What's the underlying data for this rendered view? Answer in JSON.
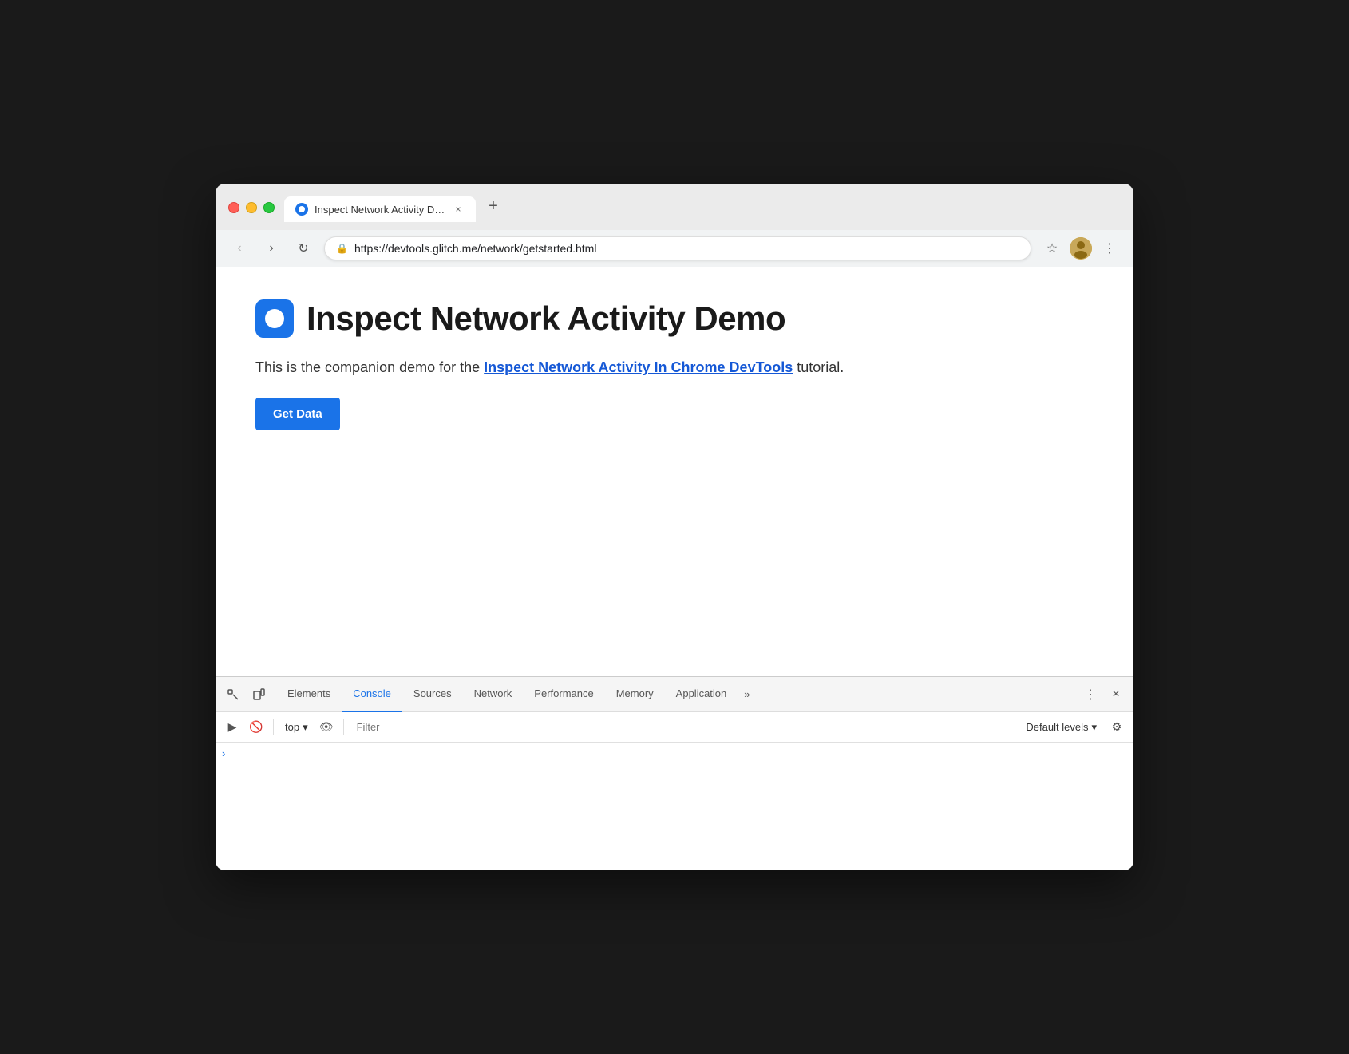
{
  "browser": {
    "traffic_lights": {
      "close_label": "close",
      "minimize_label": "minimize",
      "maximize_label": "maximize"
    },
    "tab": {
      "title": "Inspect Network Activity Demo",
      "close_label": "×"
    },
    "new_tab_label": "+",
    "nav": {
      "back_label": "‹",
      "forward_label": "›",
      "reload_label": "↻"
    },
    "address": {
      "lock_icon": "🔒",
      "url_base": "https://devtools.glitch.me",
      "url_path": "/network/getstarted.html"
    },
    "star_label": "☆",
    "menu_label": "⋮"
  },
  "page": {
    "favicon_alt": "devtools favicon",
    "title": "Inspect Network Activity Demo",
    "description_prefix": "This is the companion demo for the ",
    "link_text": "Inspect Network Activity In Chrome DevTools",
    "description_suffix": " tutorial.",
    "get_data_label": "Get Data"
  },
  "devtools": {
    "toolbar_icons": {
      "select_icon": "⬚",
      "device_icon": "▭"
    },
    "tabs": [
      {
        "id": "elements",
        "label": "Elements",
        "active": false
      },
      {
        "id": "console",
        "label": "Console",
        "active": true
      },
      {
        "id": "sources",
        "label": "Sources",
        "active": false
      },
      {
        "id": "network",
        "label": "Network",
        "active": false
      },
      {
        "id": "performance",
        "label": "Performance",
        "active": false
      },
      {
        "id": "memory",
        "label": "Memory",
        "active": false
      },
      {
        "id": "application",
        "label": "Application",
        "active": false
      }
    ],
    "more_tabs_label": "»",
    "menu_dots_label": "⋮",
    "close_label": "×"
  },
  "console": {
    "run_btn_label": "▶",
    "clear_btn_label": "🚫",
    "separator": "",
    "context": {
      "value": "top",
      "arrow": "▾"
    },
    "eye_icon": "👁",
    "filter_placeholder": "Filter",
    "levels_label": "Default levels",
    "levels_arrow": "▾",
    "gear_icon": "⚙",
    "output_arrow": "›"
  }
}
